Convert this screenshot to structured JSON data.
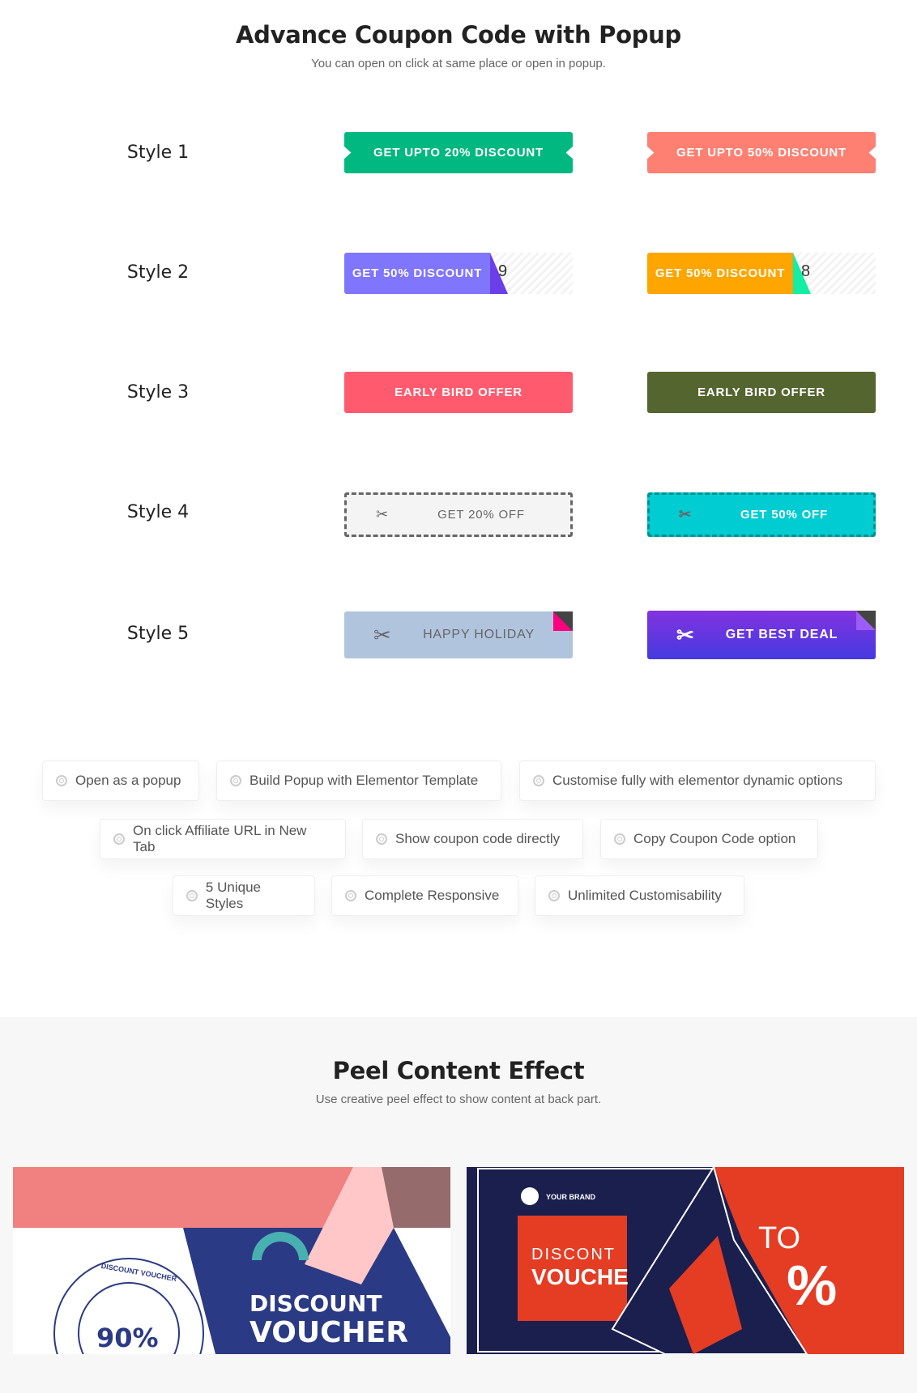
{
  "section1": {
    "title": "Advance Coupon Code with Popup",
    "subtitle": "You can open on click at same place or open in popup."
  },
  "styles": [
    {
      "label": "Style 1",
      "left": {
        "text": "GET UPTO 20% DISCOUNT",
        "color": "#00b880"
      },
      "right": {
        "text": "GET UPTO 50% DISCOUNT",
        "color": "#fd8072"
      }
    },
    {
      "label": "Style 2",
      "left": {
        "text": "GET 50% DISCOUNT",
        "code": "9",
        "color": "#8075fd",
        "fold": "#6a3ee8"
      },
      "right": {
        "text": "GET 50% DISCOUNT",
        "code": "8",
        "color": "#ffa500",
        "fold": "#13eea4"
      }
    },
    {
      "label": "Style 3",
      "left": {
        "text": "EARLY BIRD OFFER",
        "color": "#ff5a6e"
      },
      "right": {
        "text": "EARLY BIRD OFFER",
        "color": "#546530"
      }
    },
    {
      "label": "Style 4",
      "left": {
        "text": "GET 20% OFF",
        "icon": "scissors-icon",
        "color": "#f4f4f4"
      },
      "right": {
        "text": "GET 50% OFF",
        "icon": "scissors-icon",
        "color": "#00ccd2"
      }
    },
    {
      "label": "Style 5",
      "left": {
        "text": "HAPPY HOLIDAY",
        "icon": "scissors-icon",
        "color": "#b0c4de",
        "corner": "#ff0080"
      },
      "right": {
        "text": "GET BEST DEAL",
        "icon": "scissors-icon",
        "color": "#7b35e0",
        "corner": "#9c5cf5"
      }
    }
  ],
  "features": [
    "Open as a popup",
    "Build Popup with Elementor Template",
    "Customise fully with elementor dynamic options",
    "On click Affiliate URL in New Tab",
    "Show coupon code directly",
    "Copy Coupon Code option",
    "5 Unique Styles",
    "Complete Responsive",
    "Unlimited Customisability"
  ],
  "section2": {
    "title": "Peel Content Effect",
    "subtitle": "Use creative peel effect to show content at back part."
  },
  "peel_left": {
    "heading1": "DISCOUNT",
    "heading2": "VOUCHER",
    "badge": "90%",
    "ring": "DISCOUNT VOUCHER"
  },
  "peel_right": {
    "brand": "YOUR BRAND",
    "line1": "DISCONT",
    "line2": "VOUCHE",
    "to": "TO",
    "pct": "%"
  }
}
